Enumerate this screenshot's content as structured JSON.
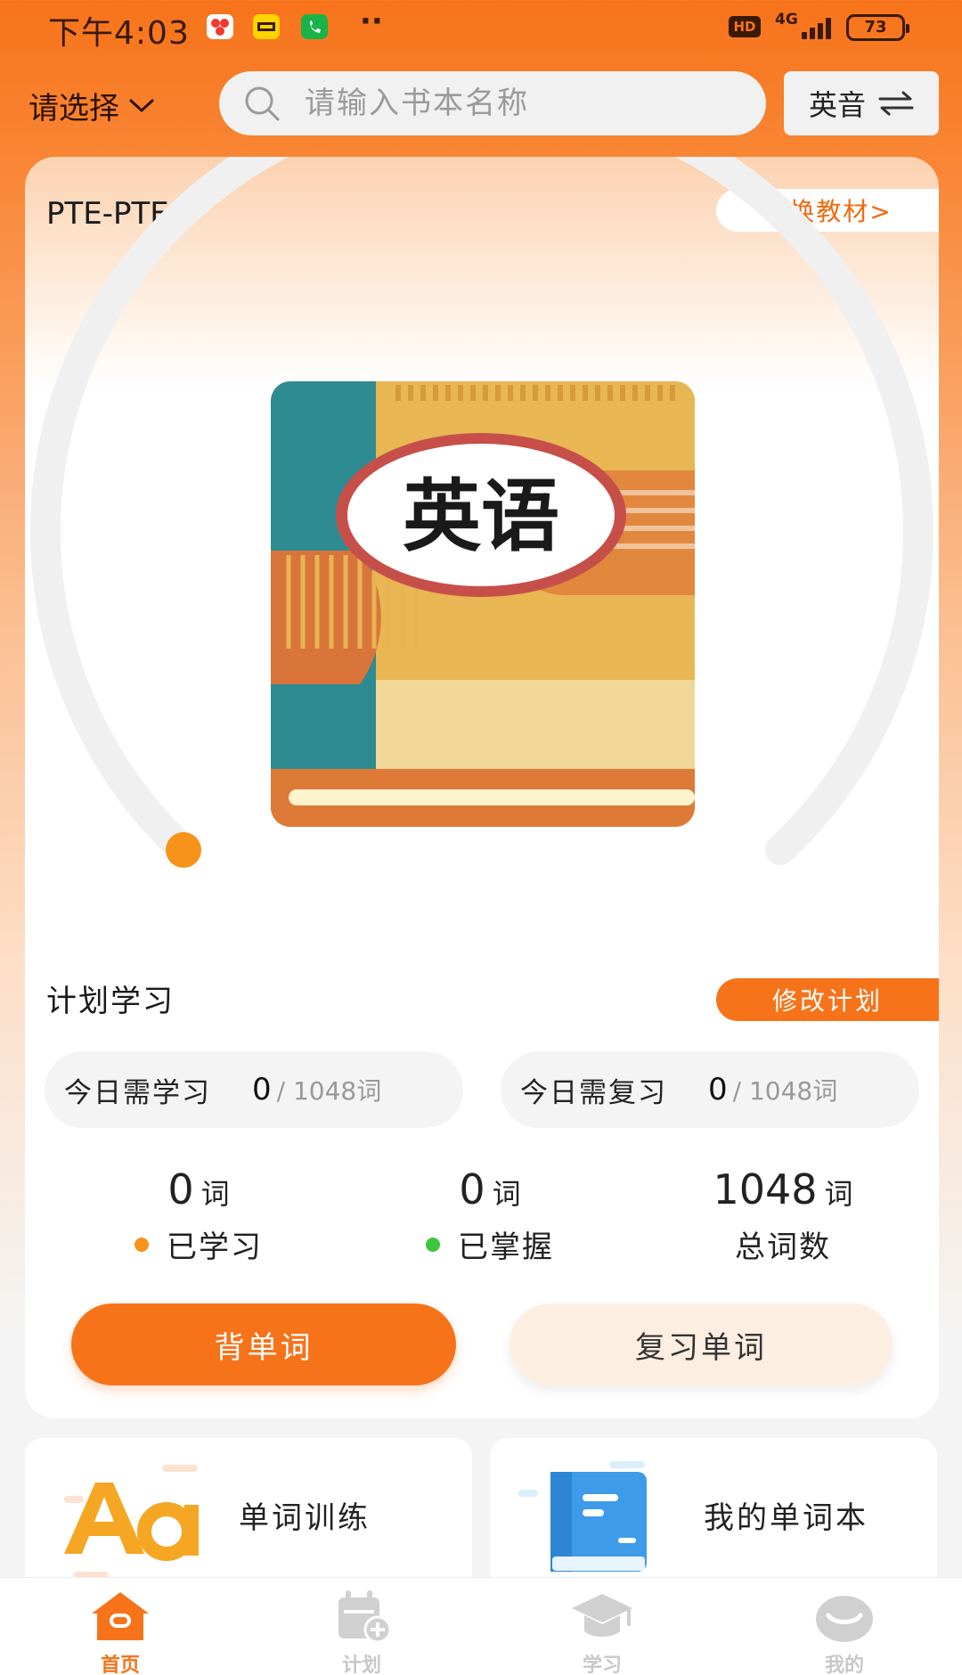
{
  "status_bar": {
    "time": "下午4:03",
    "hd": "HD",
    "network": "4G",
    "battery": "73"
  },
  "header": {
    "selector_label": "请选择",
    "search_placeholder": "请输入书本名称",
    "accent_label": "英音"
  },
  "book": {
    "title": "PTE-PTE",
    "switch_label": "切换教材>",
    "cover_text": "英语",
    "progress": 0
  },
  "plan": {
    "title": "计划学习",
    "edit_label": "修改计划",
    "today_learn": {
      "label": "今日需学习",
      "value": "0",
      "total": "/ 1048词"
    },
    "today_review": {
      "label": "今日需复习",
      "value": "0",
      "total": "/ 1048词"
    }
  },
  "stats": {
    "learned": {
      "value": "0",
      "unit": "词",
      "label": "已学习"
    },
    "mastered": {
      "value": "0",
      "unit": "词",
      "label": "已掌握"
    },
    "total": {
      "value": "1048",
      "unit": "词",
      "label": "总词数"
    }
  },
  "actions": {
    "memorize": "背单词",
    "review": "复习单词"
  },
  "features": {
    "training": "单词训练",
    "wordbook": "我的单词本"
  },
  "tabs": [
    {
      "label": "首页"
    },
    {
      "label": "计划"
    },
    {
      "label": "学习"
    },
    {
      "label": "我的"
    }
  ],
  "colors": {
    "brand": "#f7731a",
    "learned_dot": "#f7931a",
    "mastered_dot": "#3ec43e"
  }
}
